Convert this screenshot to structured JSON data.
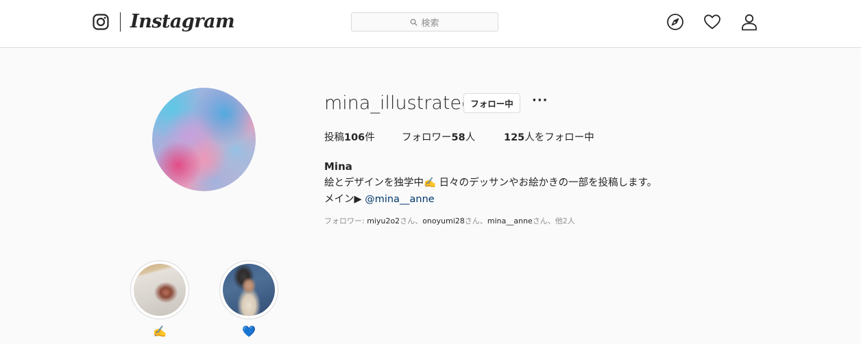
{
  "header": {
    "logo_text": "Instagram",
    "search": {
      "placeholder": "検索"
    },
    "nav_icons": [
      "compass-icon",
      "heart-icon",
      "user-icon"
    ]
  },
  "profile": {
    "username": "mina_illustrated",
    "follow_button": "フォロー中",
    "more_button": "···",
    "stats": {
      "posts_prefix": "投稿",
      "posts_count": "106",
      "posts_suffix": "件",
      "followers_prefix": "フォロワー",
      "followers_count": "58",
      "followers_suffix": "人",
      "following_count": "125",
      "following_suffix": "人をフォロー中"
    },
    "full_name": "Mina",
    "bio_line1": "絵とデザインを独学中✍️ 日々のデッサンやお絵かきの一部を投稿します。",
    "bio_line2_prefix": "メイン▶ ",
    "bio_mention": "@mina__anne",
    "followed_by": {
      "prefix": "フォロワー: ",
      "users": [
        "miyu2o2",
        "onoyumi28",
        "mina__anne"
      ],
      "honorific": "さん",
      "separator": "、",
      "suffix": "他2人"
    }
  },
  "highlights": [
    {
      "label": "✍️"
    },
    {
      "label": "💙"
    }
  ],
  "colors": {
    "background": "#fafafa",
    "border": "#dbdbdb",
    "text": "#262626",
    "secondary_text": "#8e8e8e",
    "link": "#00376b"
  }
}
